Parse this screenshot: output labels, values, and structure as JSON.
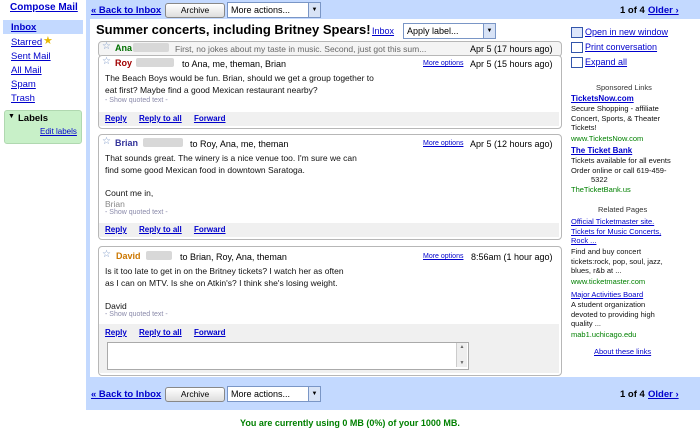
{
  "nav": {
    "compose": "Compose Mail",
    "items": [
      {
        "label": "Inbox"
      },
      {
        "label": "Starred"
      },
      {
        "label": "Sent Mail"
      },
      {
        "label": "All Mail"
      },
      {
        "label": "Spam"
      },
      {
        "label": "Trash"
      }
    ],
    "labels_title": "Labels",
    "edit_labels": "Edit labels"
  },
  "toolbar": {
    "back": "« Back to Inbox",
    "archive": "Archive",
    "more_actions": "More actions...",
    "pager": "1 of 4",
    "older": "Older ›"
  },
  "conversation": {
    "subject": "Summer concerts, including Britney Spears!",
    "inbox_label": "Inbox",
    "apply_label": "Apply label...",
    "collapsed": {
      "sender": "Ana",
      "snippet": "First, no jokes about my taste in music. Second, just got this sum...",
      "time": "Apr 5 (17 hours ago)"
    },
    "messages": [
      {
        "sender": "Roy",
        "to": "to Ana, me, theman, Brian",
        "more_options": "More options",
        "time": "Apr 5 (15 hours ago)",
        "lines": [
          "The Beach Boys would be fun.  Brian, should we get a group together to",
          "eat first?  Maybe find a good Mexican restaurant nearby?"
        ],
        "quoted": "- Show quoted text -"
      },
      {
        "sender": "Brian",
        "to": "to Roy, Ana, me, theman",
        "more_options": "More options",
        "time": "Apr 5 (12 hours ago)",
        "lines": [
          "That sounds great.  The winery is a nice venue too.  I'm sure we can",
          "find some good Mexican food in downtown Saratoga.",
          "",
          "Count me in,"
        ],
        "signature": "Brian",
        "quoted": "- Show quoted text -"
      },
      {
        "sender": "David",
        "to": "to Brian, Roy, Ana, theman",
        "more_options": "More options",
        "time": "8:56am (1 hour ago)",
        "lines": [
          "Is it too late to get in on the Britney tickets?  I watch her as often",
          "as I can on MTV.  Is she on Atkin's?  I think she's losing weight.",
          "",
          "David"
        ],
        "quoted": "- Show quoted text -"
      }
    ],
    "reply": "Reply",
    "reply_all": "Reply to all",
    "forward": "Forward"
  },
  "right": {
    "open_new_window": "Open in new window",
    "print": "Print conversation",
    "expand_all": "Expand all",
    "sponsored": "Sponsored Links",
    "ads": [
      {
        "title": "TicketsNow.com",
        "text": [
          "Secure Shopping - affiliate",
          "Concert, Sports, & Theater",
          "Tickets!"
        ],
        "url": "www.TicketsNow.com"
      },
      {
        "title": "The Ticket Bank",
        "text": [
          "Tickets available for all events",
          "Order online or call 619-459-",
          "5322"
        ],
        "url": "TheTicketBank.us"
      }
    ],
    "related": "Related Pages",
    "pages": [
      {
        "title": [
          "Official Ticketmaster site.",
          "Tickets for Music Concerts,",
          "Rock ..."
        ],
        "text": [
          "Find and buy concert",
          "tickets:rock, pop, soul, jazz,",
          "blues, r&b at ..."
        ],
        "url": "www.ticketmaster.com"
      },
      {
        "title": [
          "Major Activities Board"
        ],
        "text": [
          "A student organization",
          "devoted to providing high",
          "quality ..."
        ],
        "url": "mab1.uchicago.edu"
      }
    ],
    "about": "About these links"
  },
  "footer": "You are currently using 0 MB (0%) of your 1000 MB."
}
